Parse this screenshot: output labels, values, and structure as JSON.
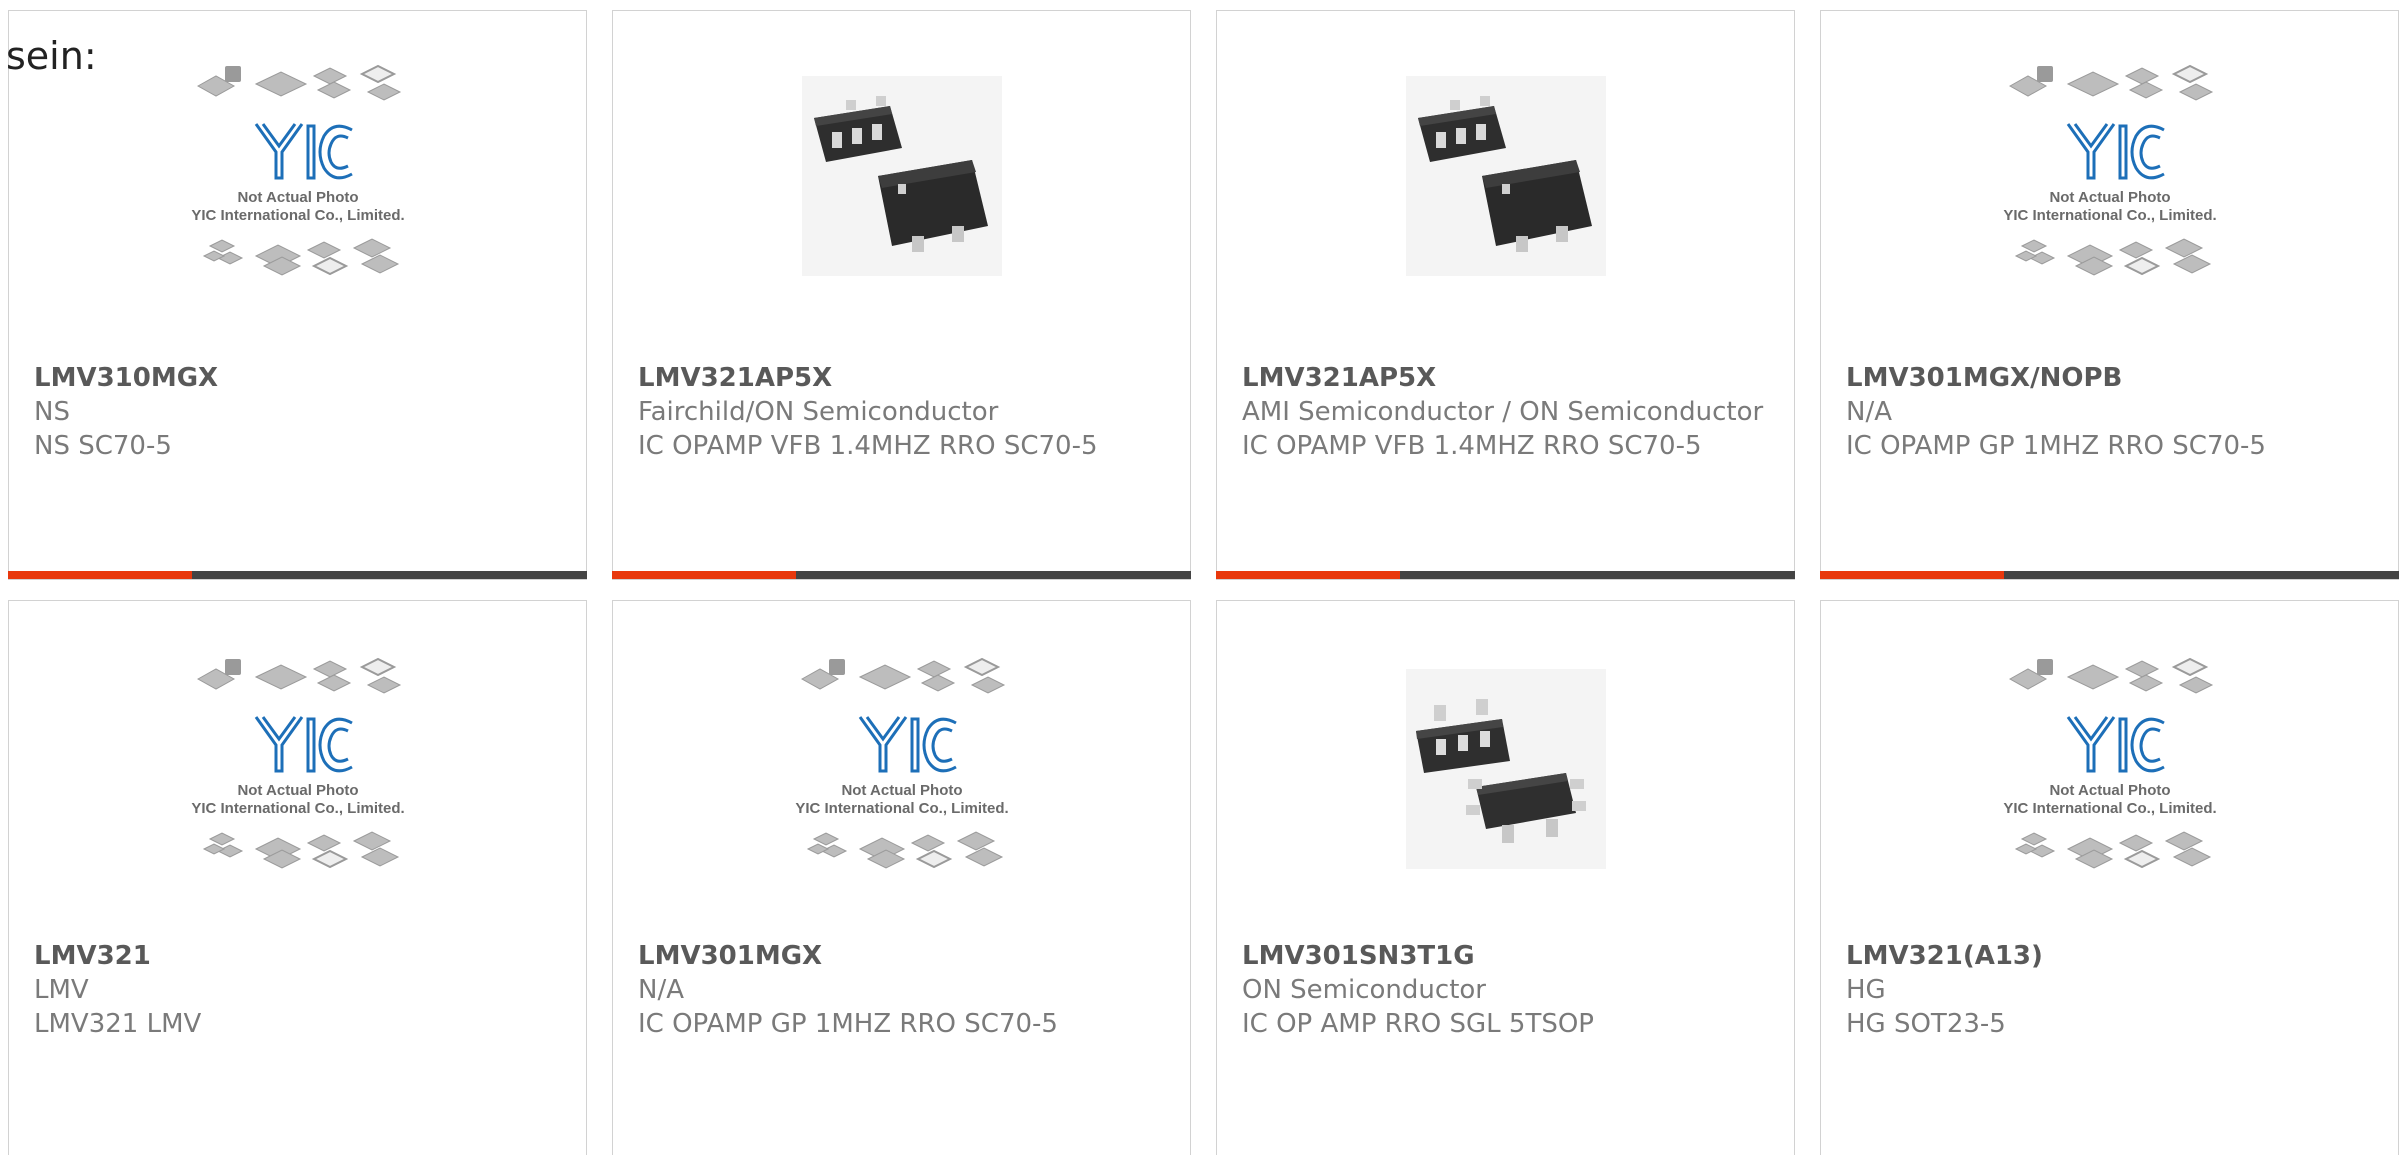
{
  "intro_text": "sein:",
  "colors": {
    "accent": "#e8380d",
    "bar": "#444444",
    "yic_blue": "#1d6fb8"
  },
  "placeholder": {
    "line1": "Not Actual Photo",
    "line2": "YIC International Co., Limited."
  },
  "products": [
    {
      "part": "LMV310MGX",
      "maker": "NS",
      "desc": "NS SC70-5",
      "image": "placeholder-photo"
    },
    {
      "part": "LMV321AP5X",
      "maker": "Fairchild/ON Semiconductor",
      "desc": "IC OPAMP VFB 1.4MHZ RRO SC70-5",
      "image": "sc70-5-package-photo"
    },
    {
      "part": "LMV321AP5X",
      "maker": "AMI Semiconductor / ON Semiconductor",
      "desc": "IC OPAMP VFB 1.4MHZ RRO SC70-5",
      "image": "sc70-5-package-photo"
    },
    {
      "part": "LMV301MGX/NOPB",
      "maker": "N/A",
      "desc": "IC OPAMP GP 1MHZ RRO SC70-5",
      "image": "placeholder-photo"
    },
    {
      "part": "LMV321",
      "maker": "LMV",
      "desc": "LMV321 LMV",
      "image": "placeholder-photo"
    },
    {
      "part": "LMV301MGX",
      "maker": "N/A",
      "desc": "IC OPAMP GP 1MHZ RRO SC70-5",
      "image": "placeholder-photo"
    },
    {
      "part": "LMV301SN3T1G",
      "maker": "ON Semiconductor",
      "desc": "IC OP AMP RRO SGL 5TSOP",
      "image": "tsop-5-package-photo"
    },
    {
      "part": "LMV321(A13)",
      "maker": "HG",
      "desc": "HG SOT23-5",
      "image": "placeholder-photo"
    }
  ]
}
